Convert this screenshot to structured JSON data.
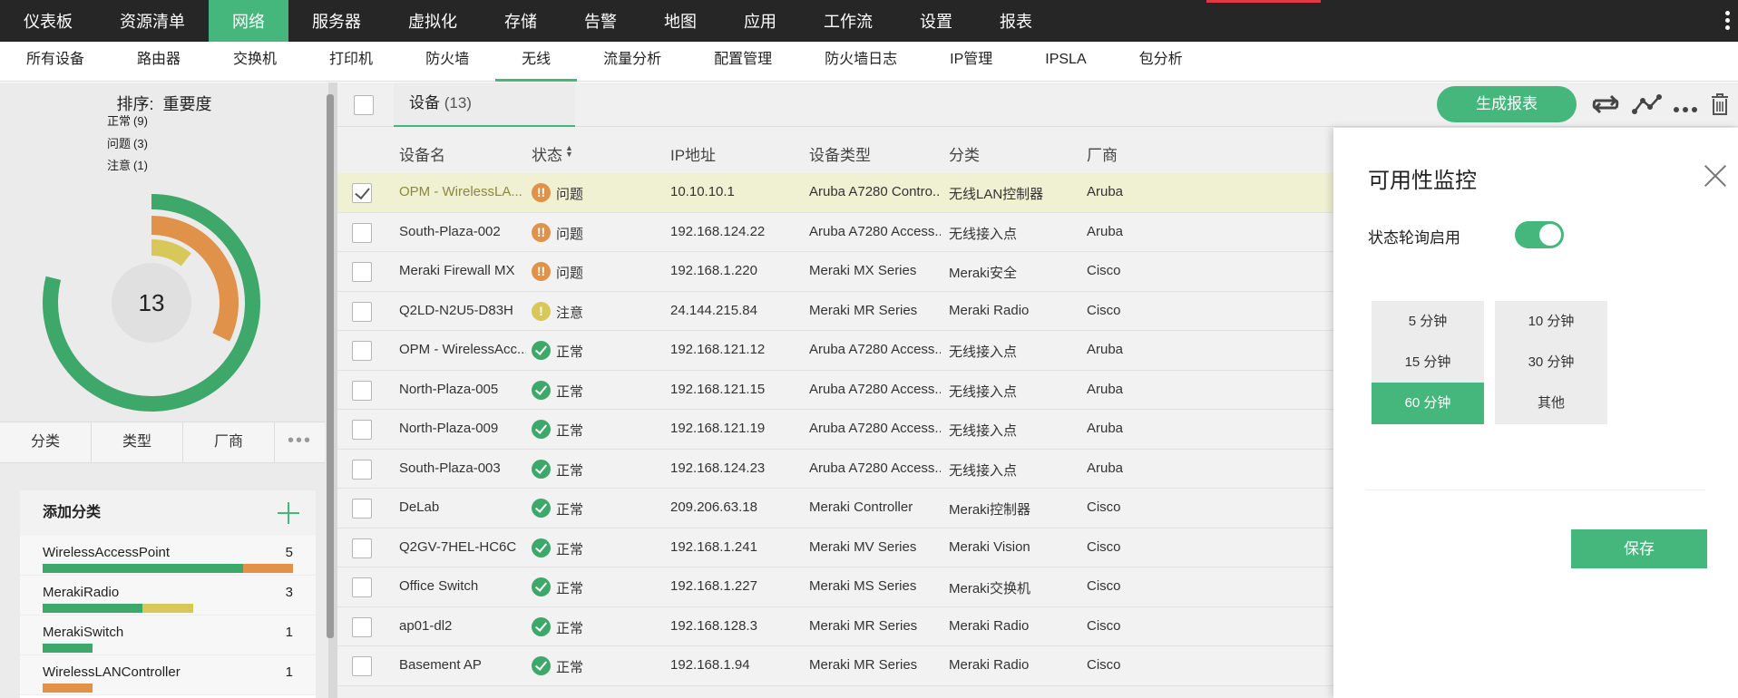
{
  "topnav": {
    "items": [
      "仪表板",
      "资源清单",
      "网络",
      "服务器",
      "虚拟化",
      "存储",
      "告警",
      "地图",
      "应用",
      "工作流",
      "设置",
      "报表"
    ],
    "active_index": 2
  },
  "subnav": {
    "items": [
      "所有设备",
      "路由器",
      "交换机",
      "打印机",
      "防火墙",
      "无线",
      "流量分析",
      "配置管理",
      "防火墙日志",
      "IP管理",
      "IPSLA",
      "包分析"
    ],
    "active_index": 5
  },
  "left": {
    "sort_label": "排序:",
    "sort_value": "重要度",
    "donut": {
      "total": "13",
      "segments": [
        {
          "label": "正常",
          "count": "(9)",
          "value": 9,
          "color": "#3ea86a"
        },
        {
          "label": "问题",
          "count": "(3)",
          "value": 3,
          "color": "#e0924a"
        },
        {
          "label": "注意",
          "count": "(1)",
          "value": 1,
          "color": "#d8c85a"
        }
      ]
    },
    "tabs": [
      "分类",
      "类型",
      "厂商"
    ],
    "tabs_more": "•••",
    "category_header": "添加分类",
    "categories": [
      {
        "name": "WirelessAccessPoint",
        "count": "5",
        "segments": [
          {
            "value": 4,
            "color": "#3ea86a"
          },
          {
            "value": 1,
            "color": "#e0924a"
          }
        ]
      },
      {
        "name": "MerakiRadio",
        "count": "3",
        "segments": [
          {
            "value": 2,
            "color": "#3ea86a"
          },
          {
            "value": 1,
            "color": "#d8c85a"
          }
        ]
      },
      {
        "name": "MerakiSwitch",
        "count": "1",
        "segments": [
          {
            "value": 1,
            "color": "#3ea86a"
          }
        ]
      },
      {
        "name": "WirelessLANController",
        "count": "1",
        "segments": [
          {
            "value": 1,
            "color": "#e0924a"
          }
        ]
      }
    ]
  },
  "toolbar": {
    "devices_tab": "设备",
    "devices_count": "(13)",
    "generate_report": "生成报表"
  },
  "table": {
    "headers": [
      "设备名",
      "状态",
      "IP地址",
      "设备类型",
      "分类",
      "厂商"
    ],
    "rows": [
      {
        "name": "OPM - WirelessLA...",
        "status": "问题",
        "level": "problem",
        "ip": "10.10.10.1",
        "type": "Aruba A7280 Contro...",
        "category": "无线LAN控制器",
        "vendor": "Aruba",
        "selected": true
      },
      {
        "name": "South-Plaza-002",
        "status": "问题",
        "level": "problem",
        "ip": "192.168.124.22",
        "type": "Aruba A7280 Access...",
        "category": "无线接入点",
        "vendor": "Aruba"
      },
      {
        "name": "Meraki Firewall MX",
        "status": "问题",
        "level": "problem",
        "ip": "192.168.1.220",
        "type": "Meraki MX Series",
        "category": "Meraki安全",
        "vendor": "Cisco"
      },
      {
        "name": "Q2LD-N2U5-D83H",
        "status": "注意",
        "level": "attention",
        "ip": "24.144.215.84",
        "type": "Meraki MR Series",
        "category": "Meraki Radio",
        "vendor": "Cisco"
      },
      {
        "name": "OPM - WirelessAcc...",
        "status": "正常",
        "level": "ok",
        "ip": "192.168.121.12",
        "type": "Aruba A7280 Access...",
        "category": "无线接入点",
        "vendor": "Aruba"
      },
      {
        "name": "North-Plaza-005",
        "status": "正常",
        "level": "ok",
        "ip": "192.168.121.15",
        "type": "Aruba A7280 Access...",
        "category": "无线接入点",
        "vendor": "Aruba"
      },
      {
        "name": "North-Plaza-009",
        "status": "正常",
        "level": "ok",
        "ip": "192.168.121.19",
        "type": "Aruba A7280 Access...",
        "category": "无线接入点",
        "vendor": "Aruba"
      },
      {
        "name": "South-Plaza-003",
        "status": "正常",
        "level": "ok",
        "ip": "192.168.124.23",
        "type": "Aruba A7280 Access...",
        "category": "无线接入点",
        "vendor": "Aruba"
      },
      {
        "name": "DeLab",
        "status": "正常",
        "level": "ok",
        "ip": "209.206.63.18",
        "type": "Meraki Controller",
        "category": "Meraki控制器",
        "vendor": "Cisco"
      },
      {
        "name": "Q2GV-7HEL-HC6C",
        "status": "正常",
        "level": "ok",
        "ip": "192.168.1.241",
        "type": "Meraki MV Series",
        "category": "Meraki Vision",
        "vendor": "Cisco"
      },
      {
        "name": "Office Switch",
        "status": "正常",
        "level": "ok",
        "ip": "192.168.1.227",
        "type": "Meraki MS Series",
        "category": "Meraki交换机",
        "vendor": "Cisco"
      },
      {
        "name": "ap01-dl2",
        "status": "正常",
        "level": "ok",
        "ip": "192.168.128.3",
        "type": "Meraki MR Series",
        "category": "Meraki Radio",
        "vendor": "Cisco"
      },
      {
        "name": "Basement AP",
        "status": "正常",
        "level": "ok",
        "ip": "192.168.1.94",
        "type": "Meraki MR Series",
        "category": "Meraki Radio",
        "vendor": "Cisco"
      }
    ]
  },
  "panel": {
    "title": "可用性监控",
    "poll_label": "状态轮询启用",
    "poll_enabled": true,
    "intervals": [
      "5 分钟",
      "10 分钟",
      "15 分钟",
      "30 分钟",
      "60 分钟",
      "其他"
    ],
    "selected_interval_index": 4,
    "save": "保存"
  },
  "colors": {
    "accent": "#45b77c",
    "ok": "#3ea86a",
    "problem": "#e0924a",
    "attention": "#d8c85a",
    "topnav_bg": "#262626"
  }
}
